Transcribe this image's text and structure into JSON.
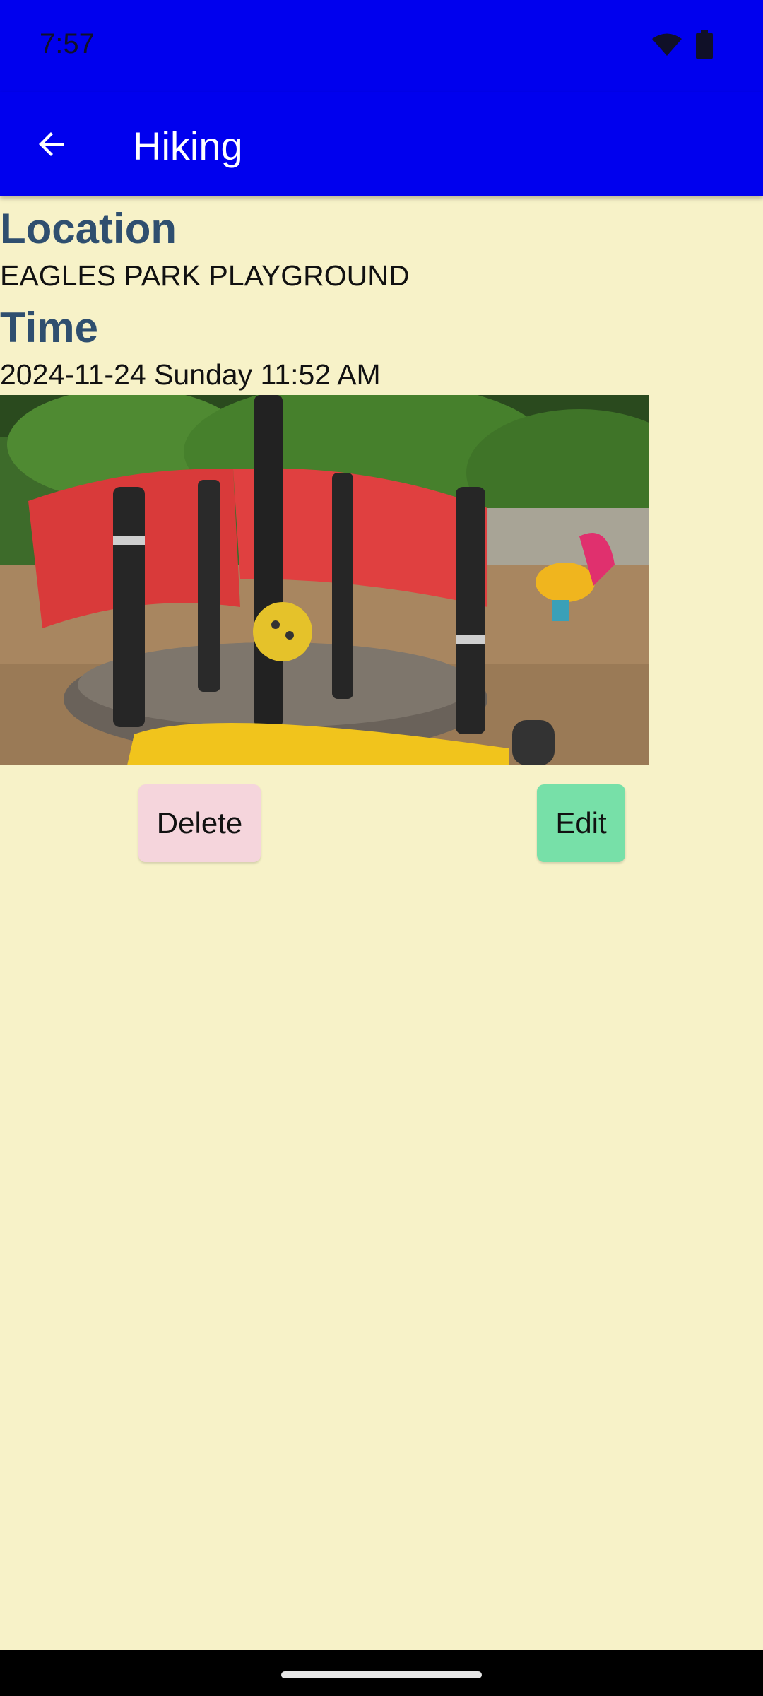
{
  "status": {
    "time": "7:57",
    "icons": [
      "wifi-icon",
      "battery-icon"
    ]
  },
  "app_bar": {
    "title": "Hiking",
    "back_icon": "arrow-back-icon"
  },
  "detail": {
    "location_label": "Location",
    "location_value": "EAGLES PARK PLAYGROUND",
    "time_label": "Time",
    "time_value": "2024-11-24 Sunday 11:52 AM"
  },
  "photo": {
    "subject": "playground"
  },
  "actions": {
    "delete_label": "Delete",
    "edit_label": "Edit"
  },
  "colors": {
    "app_bar": "#0000ee",
    "background": "#f7f2c8",
    "label": "#2f4f6f",
    "delete_button": "#f5d5dc",
    "edit_button": "#77e0a8"
  }
}
